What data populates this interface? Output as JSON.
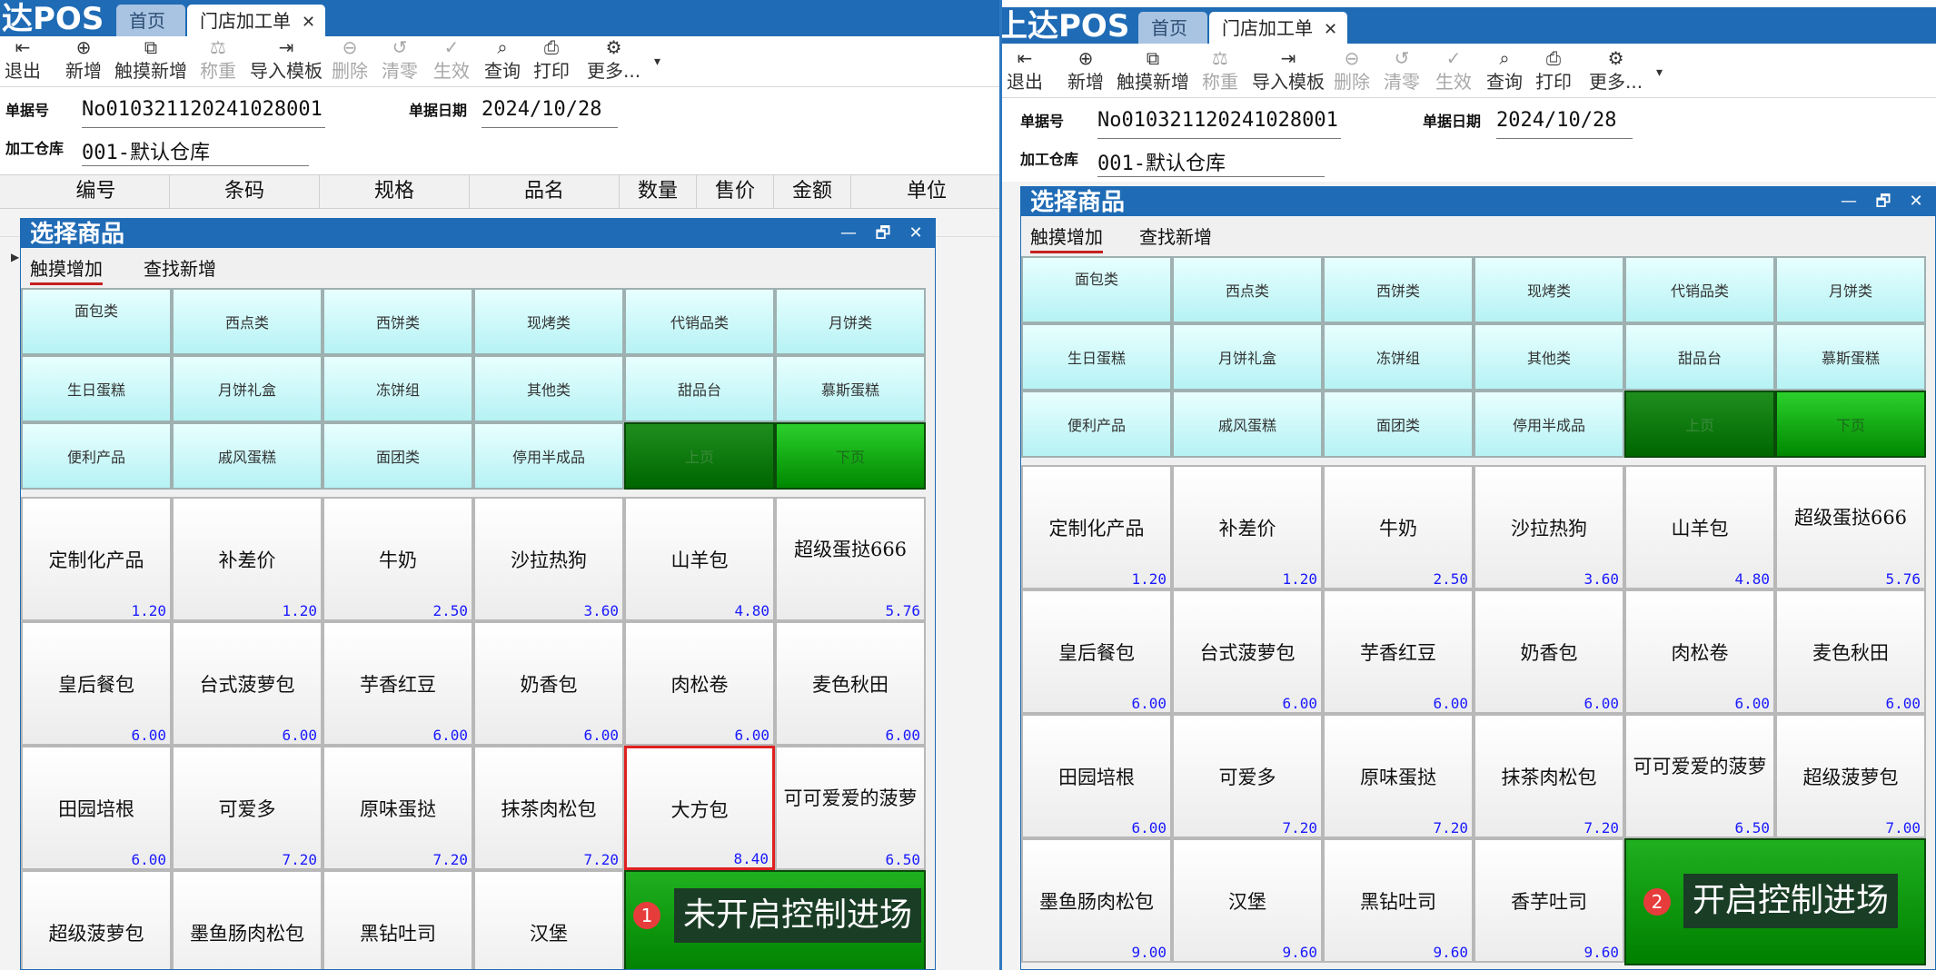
{
  "left": {
    "logo": "达POS",
    "tabs": {
      "home": "首页",
      "active": "门店加工单",
      "close": "✕"
    },
    "toolbar": [
      {
        "label": "退出",
        "icon": "⇤",
        "disabled": false
      },
      {
        "label": "新增",
        "icon": "⊕",
        "disabled": false
      },
      {
        "label": "触摸新增",
        "icon": "⧉",
        "disabled": false
      },
      {
        "label": "称重",
        "icon": "⚖",
        "disabled": true
      },
      {
        "label": "导入模板",
        "icon": "⇥",
        "disabled": false
      },
      {
        "label": "删除",
        "icon": "⊖",
        "disabled": true
      },
      {
        "label": "清零",
        "icon": "↺",
        "disabled": true
      },
      {
        "label": "生效",
        "icon": "✓",
        "disabled": true
      },
      {
        "label": "查询",
        "icon": "⌕",
        "disabled": false
      },
      {
        "label": "打印",
        "icon": "⎙",
        "disabled": false
      },
      {
        "label": "更多...",
        "icon": "⚙",
        "disabled": false
      }
    ],
    "doc_no_label": "单据号",
    "doc_no": "No010321120241028001",
    "doc_date_label": "单据日期",
    "doc_date": "2024/10/28",
    "warehouse_label": "加工仓库",
    "warehouse": "001-默认仓库",
    "columns": [
      "编号",
      "条码",
      "规格",
      "品名",
      "数量",
      "售价",
      "金额",
      "单位"
    ],
    "dialog": {
      "title": "选择商品",
      "tab_touch": "触摸增加",
      "tab_search": "查找新增",
      "min": "—",
      "restore": "🗗",
      "close": "✕"
    },
    "categories": [
      "面包类",
      "西点类",
      "西饼类",
      "现烤类",
      "代销品类",
      "月饼类",
      "生日蛋糕",
      "月饼礼盒",
      "冻饼组",
      "其他类",
      "甜品台",
      "慕斯蛋糕",
      "便利产品",
      "戚风蛋糕",
      "面团类",
      "停用半成品",
      "上页",
      "下页"
    ],
    "products": [
      {
        "name": "定制化产品",
        "price": "1.20"
      },
      {
        "name": "补差价",
        "price": "1.20"
      },
      {
        "name": "牛奶",
        "price": "2.50"
      },
      {
        "name": "沙拉热狗",
        "price": "3.60"
      },
      {
        "name": "山羊包",
        "price": "4.80"
      },
      {
        "name": "超级蛋挞666",
        "price": "5.76"
      },
      {
        "name": "皇后餐包",
        "price": "6.00"
      },
      {
        "name": "台式菠萝包",
        "price": "6.00"
      },
      {
        "name": "芋香红豆",
        "price": "6.00"
      },
      {
        "name": "奶香包",
        "price": "6.00"
      },
      {
        "name": "肉松卷",
        "price": "6.00"
      },
      {
        "name": "麦色秋田",
        "price": "6.00"
      },
      {
        "name": "田园培根",
        "price": "6.00"
      },
      {
        "name": "可爱多",
        "price": "7.20"
      },
      {
        "name": "原味蛋挞",
        "price": "7.20"
      },
      {
        "name": "抹茶肉松包",
        "price": "7.20"
      },
      {
        "name": "大方包",
        "price": "8.40"
      },
      {
        "name": "可可爱爱的菠萝",
        "price": "6.50"
      },
      {
        "name": "超级菠萝包",
        "price": ""
      },
      {
        "name": "墨鱼肠肉松包",
        "price": ""
      },
      {
        "name": "黑钻吐司",
        "price": ""
      },
      {
        "name": "汉堡",
        "price": ""
      }
    ],
    "callout_num": "1",
    "callout": "未开启控制进场"
  },
  "right": {
    "logo": "上达POS",
    "tabs": {
      "home": "首页",
      "active": "门店加工单",
      "close": "✕"
    },
    "toolbar": [
      {
        "label": "退出",
        "icon": "⇤",
        "disabled": false
      },
      {
        "label": "新增",
        "icon": "⊕",
        "disabled": false
      },
      {
        "label": "触摸新增",
        "icon": "⧉",
        "disabled": false
      },
      {
        "label": "称重",
        "icon": "⚖",
        "disabled": true
      },
      {
        "label": "导入模板",
        "icon": "⇥",
        "disabled": false
      },
      {
        "label": "删除",
        "icon": "⊖",
        "disabled": true
      },
      {
        "label": "清零",
        "icon": "↺",
        "disabled": true
      },
      {
        "label": "生效",
        "icon": "✓",
        "disabled": true
      },
      {
        "label": "查询",
        "icon": "⌕",
        "disabled": false
      },
      {
        "label": "打印",
        "icon": "⎙",
        "disabled": false
      },
      {
        "label": "更多...",
        "icon": "⚙",
        "disabled": false
      }
    ],
    "doc_no_label": "单据号",
    "doc_no": "No010321120241028001",
    "doc_date_label": "单据日期",
    "doc_date": "2024/10/28",
    "warehouse_label": "加工仓库",
    "warehouse": "001-默认仓库",
    "dialog": {
      "title": "选择商品",
      "tab_touch": "触摸增加",
      "tab_search": "查找新增",
      "min": "—",
      "restore": "🗗",
      "close": "✕"
    },
    "categories": [
      "面包类",
      "西点类",
      "西饼类",
      "现烤类",
      "代销品类",
      "月饼类",
      "生日蛋糕",
      "月饼礼盒",
      "冻饼组",
      "其他类",
      "甜品台",
      "慕斯蛋糕",
      "便利产品",
      "戚风蛋糕",
      "面团类",
      "停用半成品",
      "上页",
      "下页"
    ],
    "products": [
      {
        "name": "定制化产品",
        "price": "1.20"
      },
      {
        "name": "补差价",
        "price": "1.20"
      },
      {
        "name": "牛奶",
        "price": "2.50"
      },
      {
        "name": "沙拉热狗",
        "price": "3.60"
      },
      {
        "name": "山羊包",
        "price": "4.80"
      },
      {
        "name": "超级蛋挞666",
        "price": "5.76"
      },
      {
        "name": "皇后餐包",
        "price": "6.00"
      },
      {
        "name": "台式菠萝包",
        "price": "6.00"
      },
      {
        "name": "芋香红豆",
        "price": "6.00"
      },
      {
        "name": "奶香包",
        "price": "6.00"
      },
      {
        "name": "肉松卷",
        "price": "6.00"
      },
      {
        "name": "麦色秋田",
        "price": "6.00"
      },
      {
        "name": "田园培根",
        "price": "6.00"
      },
      {
        "name": "可爱多",
        "price": "7.20"
      },
      {
        "name": "原味蛋挞",
        "price": "7.20"
      },
      {
        "name": "抹茶肉松包",
        "price": "7.20"
      },
      {
        "name": "可可爱爱的菠萝",
        "price": "6.50"
      },
      {
        "name": "超级菠萝包",
        "price": "7.00"
      },
      {
        "name": "墨鱼肠肉松包",
        "price": "9.00"
      },
      {
        "name": "汉堡",
        "price": "9.60"
      },
      {
        "name": "黑钻吐司",
        "price": "9.60"
      },
      {
        "name": "香芋吐司",
        "price": "9.60"
      }
    ],
    "callout_num": "2",
    "callout": "开启控制进场"
  }
}
